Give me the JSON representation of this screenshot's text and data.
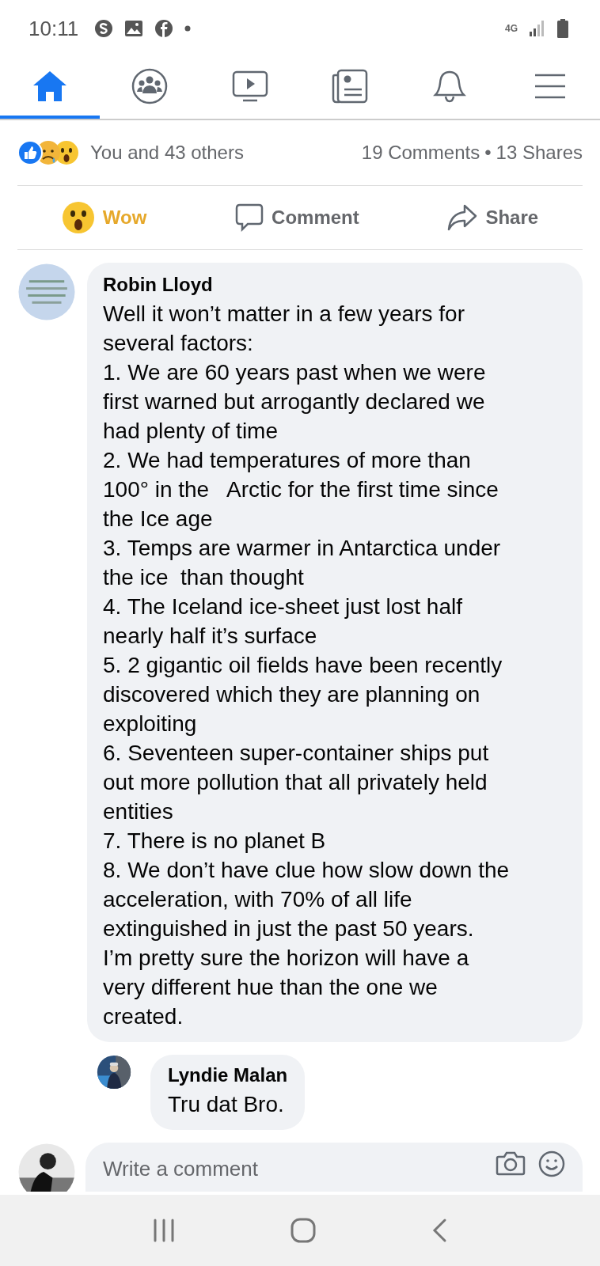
{
  "status_bar": {
    "time": "10:11",
    "network": "4G"
  },
  "tabs": [
    {
      "kind": "home",
      "selected": true
    },
    {
      "kind": "groups",
      "selected": false
    },
    {
      "kind": "watch",
      "selected": false
    },
    {
      "kind": "news",
      "selected": false
    },
    {
      "kind": "notifications",
      "selected": false
    },
    {
      "kind": "menu",
      "selected": false
    }
  ],
  "post_summary": {
    "reactions_text": "You and 43 others",
    "comments": "19 Comments",
    "separator": "•",
    "shares": "13 Shares"
  },
  "actions": [
    {
      "kind": "wow",
      "label": "Wow",
      "selected": true
    },
    {
      "kind": "comment",
      "label": "Comment",
      "selected": false
    },
    {
      "kind": "share",
      "label": "Share",
      "selected": false
    }
  ],
  "comments": [
    {
      "author": "Robin Lloyd",
      "lines": [
        "Well it won’t matter in a few years for",
        "several factors:",
        "1. We are 60 years past when we were",
        "first warned but arrogantly declared we",
        "had plenty of time",
        "2. We had temperatures of more than",
        "100° in the   Arctic for the first time since",
        "the Ice age",
        "3. Temps are warmer in Antarctica under",
        "the ice  than thought",
        "4. The Iceland ice-sheet just lost half",
        "nearly half it’s surface",
        "5. 2 gigantic oil fields have been recently",
        "discovered which they are planning on",
        "exploiting",
        "6. Seventeen super-container ships put",
        "out more pollution that all privately held",
        "entities",
        "7. There is no planet B",
        "8. We don’t have clue how slow down the",
        "acceleration, with 70% of all life",
        "extinguished in just the past 50 years.",
        "I’m pretty sure the horizon will have a",
        "very different hue than the one we",
        "created."
      ],
      "replies": [
        {
          "author": "Lyndie Malan",
          "lines": [
            "Tru dat Bro."
          ]
        }
      ]
    }
  ],
  "composer": {
    "placeholder": "Write a comment"
  }
}
